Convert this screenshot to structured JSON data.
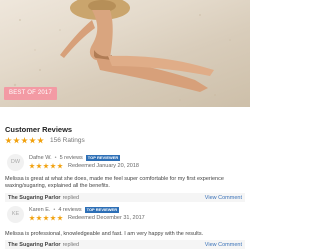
{
  "hero": {
    "badge": "BEST OF 2017"
  },
  "reviews_section": {
    "title": "Customer Reviews",
    "rating_count": "156 Ratings",
    "stars": 5
  },
  "reviews": [
    {
      "initials": "DW",
      "name": "Dafne W.",
      "review_count": "5 reviews",
      "badge": "TOP REVIEWER",
      "stars": 5,
      "redeemed": "Redeemed January 20, 2018",
      "text": "Melissa is great at what she does, made me feel super comfortable for my first experience waxing/sugaring, explained all the benefits.",
      "reply_business": "The Sugaring Parlor",
      "reply_word": "replied",
      "view_comment": "View Comment"
    },
    {
      "initials": "KE",
      "name": "Karen E.",
      "review_count": "4 reviews",
      "badge": "TOP REVIEWER",
      "stars": 5,
      "redeemed": "Redeemed December 31, 2017",
      "text": "Melissa is professional, knowledgeable and fast. I am very happy with the results.",
      "reply_business": "The Sugaring Parlor",
      "reply_word": "replied",
      "view_comment": "View Comment"
    }
  ],
  "colors": {
    "star": "#f1a10d",
    "badge_pink": "#f39aa4",
    "top_reviewer_blue": "#2d6fb6",
    "link_blue": "#3b73b9"
  }
}
